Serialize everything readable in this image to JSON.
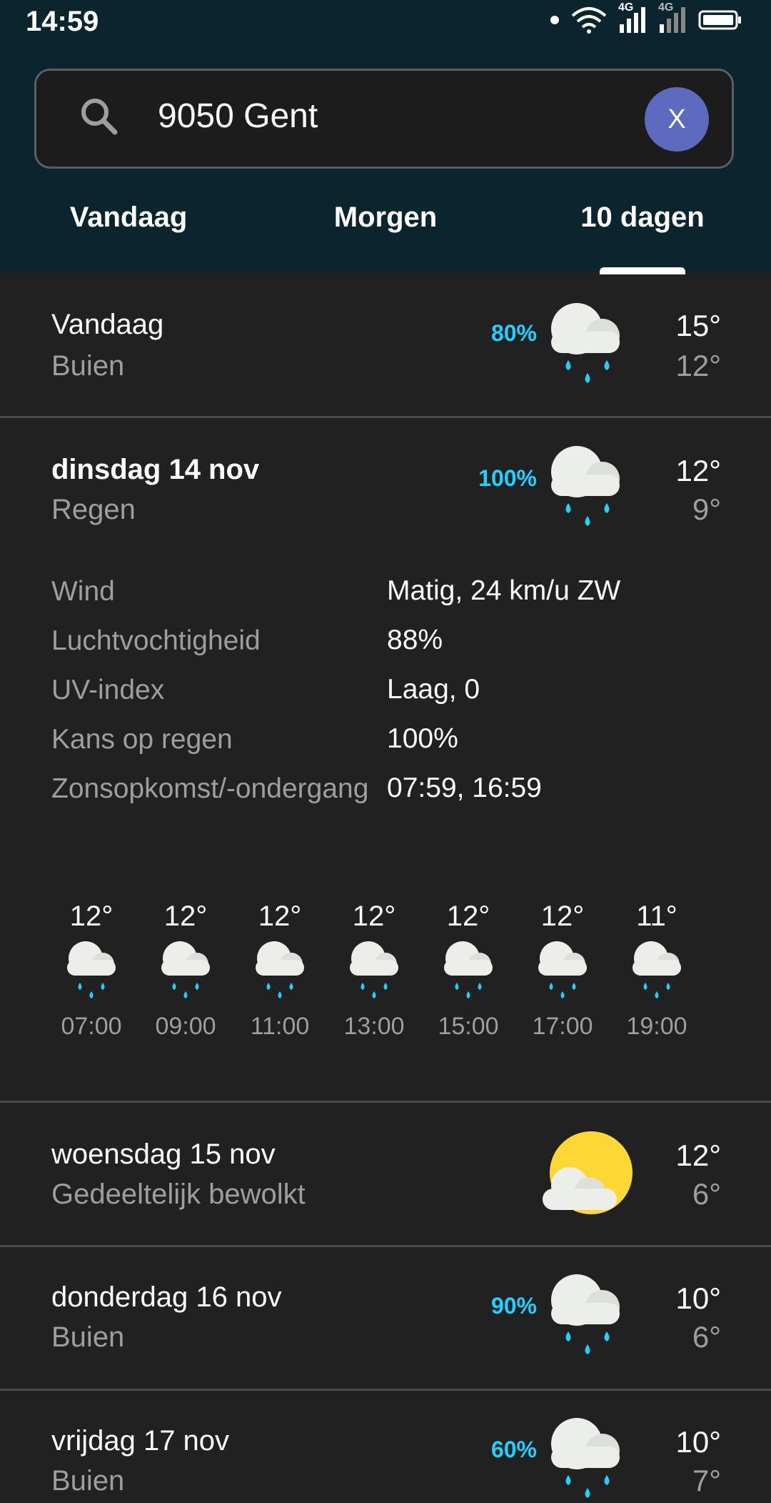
{
  "status": {
    "time": "14:59",
    "net1": "4G",
    "net2": "4G"
  },
  "search": {
    "value": "9050 Gent",
    "clear_label": "X"
  },
  "tabs": [
    {
      "label": "Vandaag"
    },
    {
      "label": "Morgen"
    },
    {
      "label": "10 dagen",
      "selected": true
    }
  ],
  "days": [
    {
      "name": "Vandaag",
      "condition": "Buien",
      "chance": "80%",
      "high": "15°",
      "low": "12°",
      "icon": "rain-cloud-icon"
    },
    {
      "name": "dinsdag 14 nov",
      "condition": "Regen",
      "chance": "100%",
      "high": "12°",
      "low": "9°",
      "icon": "rain-cloud-icon",
      "expanded": true
    },
    {
      "name": "woensdag 15 nov",
      "condition": "Gedeeltelijk bewolkt",
      "chance": "",
      "high": "12°",
      "low": "6°",
      "icon": "sun-cloud-icon"
    },
    {
      "name": "donderdag 16 nov",
      "condition": "Buien",
      "chance": "90%",
      "high": "10°",
      "low": "6°",
      "icon": "rain-cloud-icon"
    },
    {
      "name": "vrijdag 17 nov",
      "condition": "Buien",
      "chance": "60%",
      "high": "10°",
      "low": "7°",
      "icon": "rain-cloud-icon"
    }
  ],
  "details": [
    {
      "label": "Wind",
      "value": "Matig, 24 km/u ZW"
    },
    {
      "label": "Luchtvochtigheid",
      "value": "88%"
    },
    {
      "label": "UV-index",
      "value": "Laag, 0"
    },
    {
      "label": "Kans op regen",
      "value": "100%"
    },
    {
      "label": "Zonsopkomst/-ondergang",
      "value": "07:59, 16:59"
    }
  ],
  "hourly": [
    {
      "temp": "12°",
      "time": "07:00"
    },
    {
      "temp": "12°",
      "time": "09:00"
    },
    {
      "temp": "12°",
      "time": "11:00"
    },
    {
      "temp": "12°",
      "time": "13:00"
    },
    {
      "temp": "12°",
      "time": "15:00"
    },
    {
      "temp": "12°",
      "time": "17:00"
    },
    {
      "temp": "11°",
      "time": "19:00"
    }
  ],
  "colors": {
    "header_bg": "#0a252d",
    "body_bg": "#212121",
    "accent_rain": "#1ed1ff",
    "clear_button": "#5c6bc0",
    "sun": "#fdd835"
  }
}
